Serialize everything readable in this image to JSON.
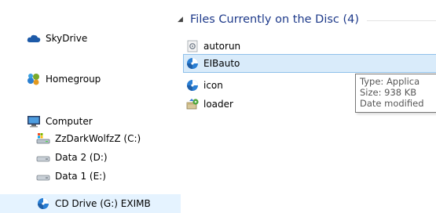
{
  "nav": {
    "items": [
      {
        "label": "SkyDrive",
        "icon": "skydrive-cloud-icon"
      },
      {
        "label": "Homegroup",
        "icon": "homegroup-icon"
      },
      {
        "label": "Computer",
        "icon": "computer-monitor-icon"
      },
      {
        "label": "ZzDarkWolfzZ (C:)",
        "icon": "system-drive-icon"
      },
      {
        "label": "Data 2 (D:)",
        "icon": "hard-drive-icon"
      },
      {
        "label": "Data 1 (E:)",
        "icon": "hard-drive-icon"
      },
      {
        "label": "CD Drive (G:) EXIMB",
        "icon": "cd-drive-icon"
      }
    ]
  },
  "content": {
    "group_title": "Files Currently on the Disc (4)",
    "files": [
      {
        "name": "autorun",
        "icon": "settings-file-icon"
      },
      {
        "name": "EIBauto",
        "icon": "application-icon"
      },
      {
        "name": "icon",
        "icon": "application-icon"
      },
      {
        "name": "loader",
        "icon": "installer-icon"
      }
    ]
  },
  "tooltip": {
    "line1": "Type: Applica",
    "line2": "Size: 938 KB",
    "line3": "Date modified"
  },
  "colors": {
    "group_title": "#1e3a8a",
    "hover_bg": "#d9ebfa",
    "selected_bg": "#e5f3ff"
  }
}
